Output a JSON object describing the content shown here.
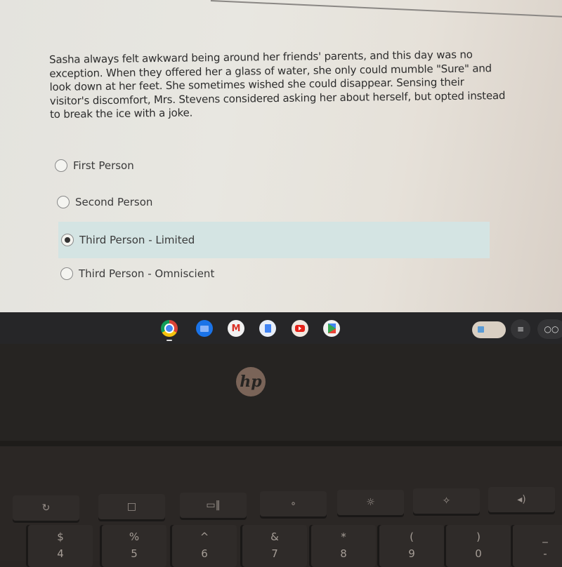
{
  "question": {
    "passage": "Sasha always felt awkward being around her friends' parents, and this day was no exception. When they offered her a glass of water, she only could mumble \"Sure\" and look down at her feet. She sometimes wished she could disappear. Sensing their visitor's discomfort, Mrs. Stevens considered asking her about herself, but opted instead to break the ice with a joke.",
    "options": [
      {
        "label": "First Person",
        "selected": false
      },
      {
        "label": "Second Person",
        "selected": false
      },
      {
        "label": "Third Person - Limited",
        "selected": true
      },
      {
        "label": "Third Person - Omniscient",
        "selected": false
      }
    ],
    "selected_highlight_color": "#d4e4e3"
  },
  "shelf": {
    "apps": [
      {
        "name": "Chrome",
        "icon": "chrome-icon"
      },
      {
        "name": "Files",
        "icon": "files-icon"
      },
      {
        "name": "Gmail",
        "icon": "gmail-icon"
      },
      {
        "name": "Docs",
        "icon": "docs-icon"
      },
      {
        "name": "YouTube",
        "icon": "youtube-icon"
      },
      {
        "name": "Play Store",
        "icon": "play-store-icon"
      }
    ]
  },
  "laptop": {
    "brand": "hp"
  },
  "keyboard": {
    "function_keys": [
      "↻",
      "□",
      "▭‖",
      "∘",
      "☼",
      "✧",
      "◂)"
    ],
    "number_keys": [
      {
        "top": "$",
        "bottom": "4"
      },
      {
        "top": "%",
        "bottom": "5"
      },
      {
        "top": "^",
        "bottom": "6"
      },
      {
        "top": "&",
        "bottom": "7"
      },
      {
        "top": "*",
        "bottom": "8"
      },
      {
        "top": "(",
        "bottom": "9"
      },
      {
        "top": ")",
        "bottom": "0"
      },
      {
        "top": "_",
        "bottom": "-"
      }
    ]
  }
}
